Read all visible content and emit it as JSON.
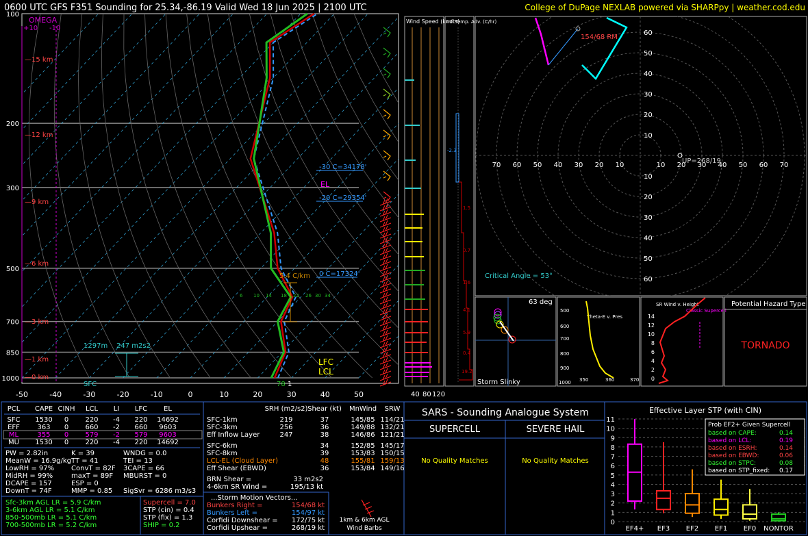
{
  "header": {
    "title": "0600 UTC GFS F351 Sounding for 25.34,-86.19 Valid  Wed 18 Jun 2025 | 2100 UTC",
    "credit": "College of DuPage NEXLAB powered via SHARPpy | weather.cod.edu"
  },
  "skewt": {
    "pressure_levels": [
      "100",
      "200",
      "300",
      "500",
      "700",
      "850",
      "1000"
    ],
    "temp_ticks": [
      "-50",
      "-40",
      "-30",
      "-20",
      "-10",
      "0",
      "10",
      "20",
      "30",
      "40",
      "50"
    ],
    "height_labels": [
      "15 km",
      "12 km",
      "9 km",
      "6 km",
      "3 km",
      "1 km",
      "0 km"
    ],
    "omega_label": "OMEGA",
    "omega_ticks": [
      "+10",
      "-10"
    ],
    "annotations": {
      "minus30": "-30 C=34178'",
      "el": "EL",
      "minus20": "-20 C=29354'",
      "zero": "0 C=17324'",
      "lapse": "5.4 C/km",
      "lfc": "LFC",
      "lcl": "LCL",
      "height_1297": "1297m",
      "srh": "247 m2s2",
      "sfc": "SFC",
      "sfc_temp": "78",
      "sfc_dew": "1"
    },
    "dcape_labels": [
      "6",
      "10",
      "14",
      "18",
      "22",
      "26",
      "30",
      "34"
    ],
    "colors": {
      "temp": "#cc0000",
      "dew": "#22bb22",
      "virtual": "#3399ff",
      "parcel": "#ffffff",
      "isotherm": "#33aadd",
      "dry": "#888888"
    }
  },
  "chart_data": [
    {
      "type": "line",
      "title": "0600 UTC GFS F351 Sounding for 25.34,-86.19 Valid  Wed 18 Jun 2025 | 2100 UTC",
      "xlabel": "",
      "ylabel": "",
      "xlim": [
        -50,
        50
      ],
      "ylim": [
        1000,
        100
      ],
      "y_scale": "log-pressure",
      "series": [
        {
          "name": "",
          "x_T": [
            26,
            22,
            12,
            8.5,
            -4,
            -15,
            -43,
            -60,
            -70,
            -65
          ],
          "y_p": [
            1000,
            850,
            700,
            600,
            500,
            400,
            250,
            150,
            120,
            100
          ]
        },
        {
          "name": "",
          "x_Td": [
            24,
            20.5,
            10,
            7,
            -7,
            -17,
            -43,
            -62,
            -72,
            -68
          ],
          "y_p": [
            1000,
            850,
            700,
            600,
            500,
            400,
            250,
            150,
            120,
            100
          ]
        }
      ]
    },
    {
      "type": "bar",
      "title": "Effective Layer STP (with CIN)",
      "categories": [
        "EF4+",
        "EF3",
        "EF2",
        "EF1",
        "EF0",
        "NONTOR"
      ],
      "box": [
        {
          "min": 1.3,
          "q1": 2.2,
          "median": 5.3,
          "q3": 8.3,
          "max": 11.0
        },
        {
          "min": 0.9,
          "q1": 1.3,
          "median": 2.5,
          "q3": 3.3,
          "max": 8.5
        },
        {
          "min": 0.5,
          "q1": 0.9,
          "median": 1.8,
          "q3": 3.0,
          "max": 5.6
        },
        {
          "min": 0.3,
          "q1": 0.7,
          "median": 1.3,
          "q3": 2.4,
          "max": 4.5
        },
        {
          "min": 0.1,
          "q1": 0.3,
          "median": 0.8,
          "q3": 1.8,
          "max": 3.5
        },
        {
          "min": 0.0,
          "q1": 0.1,
          "median": 0.3,
          "q3": 0.8,
          "max": 1.0
        }
      ],
      "ylim": [
        0,
        11
      ],
      "ticks": [
        "0",
        "1",
        "2",
        "3",
        "4",
        "5",
        "6",
        "7",
        "8",
        "9",
        "10",
        "11"
      ],
      "colors": [
        "#ff00ff",
        "#ff2222",
        "#ff8800",
        "#ffee00",
        "#ffff44",
        "#22cc22"
      ]
    }
  ],
  "wind_speed": {
    "title": "Wind Speed (knots)",
    "ticks": [
      "40",
      "80",
      "120"
    ]
  },
  "inf_temp": {
    "title": "Inf. Temp. Adv. (C/hr)",
    "values": [
      "-2.3",
      "1.5",
      "0.7",
      "1.6",
      "4.1",
      "5.9",
      "0.4",
      "19.2"
    ]
  },
  "hodograph": {
    "rings": [
      "60",
      "50",
      "40",
      "30",
      "20",
      "10"
    ],
    "xticks": [
      "70",
      "60",
      "50",
      "40",
      "30",
      "20",
      "10",
      "10",
      "20",
      "30",
      "40",
      "50",
      "60",
      "70"
    ],
    "rm_label": "154/68 RM",
    "up_label": "UP=268/19",
    "critical_angle": "Critical Angle = 53°"
  },
  "slinky": {
    "deg": "63 deg",
    "label": "Storm Slinky"
  },
  "thetae": {
    "label": "Theta-E v. Pres",
    "yticks": [
      "500",
      "600",
      "700",
      "800",
      "900",
      "1000"
    ],
    "xticks": [
      "350",
      "360",
      "370"
    ]
  },
  "srwind": {
    "label": "SR Wind v. Height",
    "classic": "Classic Supercell",
    "yticks": [
      "14",
      "12",
      "10",
      "8",
      "6",
      "4",
      "2",
      "0"
    ]
  },
  "hazard": {
    "title": "Potential Hazard Type",
    "value": "TORNADO"
  },
  "parcels": {
    "headers": [
      "PCL",
      "CAPE",
      "CINH",
      "LCL",
      "LI",
      "LFC",
      "EL"
    ],
    "rows": [
      [
        "SFC",
        "1530",
        "0",
        "220",
        "-4",
        "220",
        "14692"
      ],
      [
        "EFF",
        "363",
        "0",
        "660",
        "-2",
        "660",
        "9603"
      ],
      [
        "ML",
        "355",
        "0",
        "579",
        "-2",
        "579",
        "9603"
      ],
      [
        "MU",
        "1530",
        "0",
        "220",
        "-4",
        "220",
        "14692"
      ]
    ]
  },
  "indices": {
    "c1": [
      "PW = 2.82in",
      "MeanW = 16.9g/kg",
      "LowRH = 97%",
      "MidRH = 99%",
      "DCAPE = 157",
      "DownT = 74F"
    ],
    "c2": [
      "K = 39",
      "TT = 41",
      "ConvT = 82F",
      "maxT = 89F",
      "ESP = 0",
      "MMP = 0.85"
    ],
    "c3": [
      "WNDG = 0.0",
      "TEI = 13",
      "3CAPE = 66",
      "MBURST = 0",
      "",
      "SigSvr = 6286 m3/s3"
    ]
  },
  "lapse": [
    "Sfc-3km AGL LR = 5.9 C/km",
    "3-6km AGL LR = 5.1 C/km",
    "850-500mb LR = 5.1 C/km",
    "700-500mb LR = 5.2 C/km"
  ],
  "composite": [
    "Supercell = 7.0",
    "STP (cin) = 0.4",
    "STP (fix) = 1.3",
    "SHIP = 0.2"
  ],
  "kinematics": {
    "headers": [
      "SRH (m2/s2)",
      "Shear (kt)",
      "MnWind",
      "SRW"
    ],
    "rows": [
      [
        "SFC-1km",
        "219",
        "37",
        "145/85",
        "114/21"
      ],
      [
        "SFC-3km",
        "256",
        "36",
        "149/88",
        "132/21"
      ],
      [
        "Eff Inflow Layer",
        "247",
        "38",
        "146/86",
        "121/21"
      ],
      [
        "SFC-6km",
        "34",
        "152/85",
        "145/17"
      ],
      [
        "SFC-8km",
        "39",
        "153/83",
        "150/15"
      ],
      [
        "LCL-EL (Cloud Layer)",
        "48",
        "155/81",
        "159/13"
      ],
      [
        "Eff Shear (EBWD)",
        "36",
        "153/84",
        "149/16"
      ]
    ],
    "brn": "BRN Shear =",
    "brn_val": "33 m2s2",
    "sr46": "4-6km SR Wind =",
    "sr46_val": "195/13 kt",
    "storm_title": "...Storm Motion Vectors...",
    "motions": [
      [
        "Bunkers Right =",
        "154/68 kt"
      ],
      [
        "Bunkers Left =",
        "154/97 kt"
      ],
      [
        "Corfidi Downshear =",
        "172/75 kt"
      ],
      [
        "Corfidi Upshear =",
        "268/19 kt"
      ]
    ],
    "barbs_label": "1km & 6km AGL Wind Barbs"
  },
  "sars": {
    "title": "SARS - Sounding Analogue System",
    "supercell": "SUPERCELL",
    "hail": "SEVERE HAIL",
    "no_match": "No Quality Matches"
  },
  "stp_legend": {
    "title": "Prob EF2+ Given Supercell",
    "rows": [
      [
        "based on CAPE:",
        "0.14"
      ],
      [
        "based on LCL:",
        "0.19"
      ],
      [
        "based on ESRH:",
        "0.14"
      ],
      [
        "based on EBWD:",
        "0.06"
      ],
      [
        "based on STPC:",
        "0.08"
      ],
      [
        "based on STP_fixed:",
        "0.17"
      ]
    ]
  }
}
